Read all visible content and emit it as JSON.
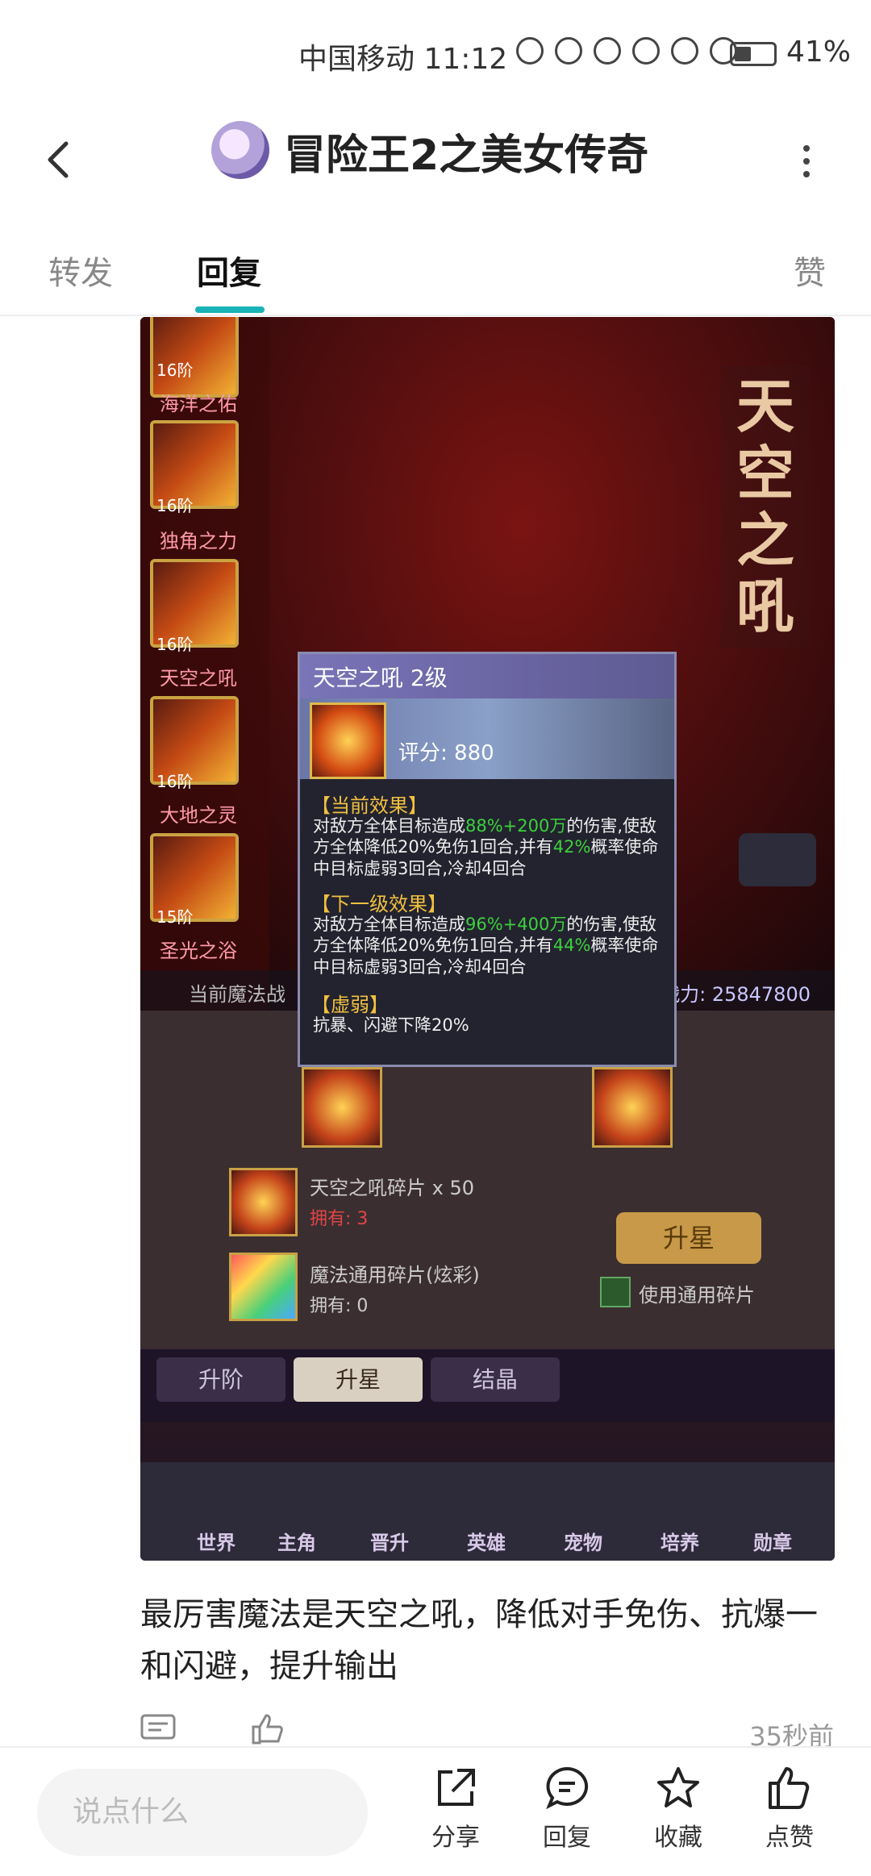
{
  "status_bar": {
    "carrier_time": "中国移动 11:12",
    "battery": "41%"
  },
  "header": {
    "title": "冒险王2之美女传奇"
  },
  "tabs": {
    "forward": "转发",
    "reply": "回复",
    "like": "赞"
  },
  "game": {
    "skills": [
      {
        "level": "16阶",
        "name": "海洋之佑"
      },
      {
        "level": "16阶",
        "name": "独角之力"
      },
      {
        "level": "16阶",
        "name": "天空之吼"
      },
      {
        "level": "16阶",
        "name": "大地之灵"
      },
      {
        "level": "15阶",
        "name": "圣光之浴"
      }
    ],
    "vertical_title": "天空之吼",
    "power_left": "当前魔法战",
    "power_right": "总战力: 25847800",
    "tooltip": {
      "title": "天空之吼 2级",
      "score": "评分: 880",
      "current_label": "【当前效果】",
      "current_text_a": "对敌方全体目标造成",
      "current_pct": "88%+200万",
      "current_text_b": "的伤害,使敌方全体降低20%免伤1回合,并有",
      "current_prob": "42%",
      "current_text_c": "概率使命中目标虚弱3回合,冷却4回合",
      "next_label": "【下一级效果】",
      "next_text_a": "对敌方全体目标造成",
      "next_pct": "96%+400万",
      "next_text_b": "的伤害,使敌方全体降低20%免伤1回合,并有",
      "next_prob": "44%",
      "next_text_c": "概率使命中目标虚弱3回合,冷却4回合",
      "weak_label": "【虚弱】",
      "weak_text": "抗暴、闪避下降20%"
    },
    "fragment1": "天空之吼碎片 x 50",
    "fragment1_owned": "拥有: 3",
    "fragment2": "魔法通用碎片(炫彩)",
    "fragment2_owned": "拥有: 0",
    "star_button": "升星",
    "use_common": "使用通用碎片",
    "subtabs": [
      "升阶",
      "升星",
      "结晶"
    ],
    "nav": [
      "世界",
      "主角",
      "晋升",
      "英雄",
      "宠物",
      "培养",
      "勋章"
    ]
  },
  "post": {
    "text": "最厉害魔法是天空之吼，降低对手免伤、抗爆一和闪避，提升输出",
    "time": "35秒前"
  },
  "bottom": {
    "placeholder": "说点什么",
    "share": "分享",
    "reply": "回复",
    "favorite": "收藏",
    "like": "点赞"
  }
}
